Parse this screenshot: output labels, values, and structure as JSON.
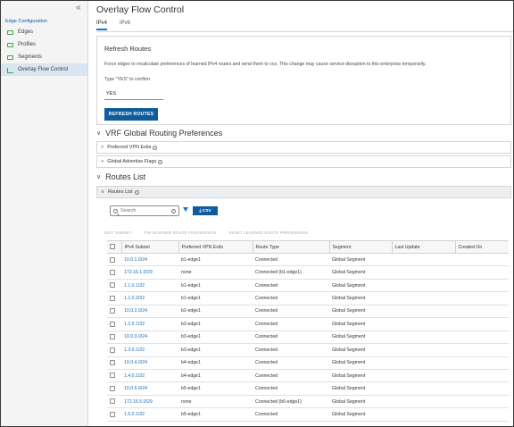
{
  "sidebar": {
    "section": "Edge Configuration",
    "items": [
      {
        "label": "Edges",
        "icon": "edge-icon"
      },
      {
        "label": "Profiles",
        "icon": "profile-icon"
      },
      {
        "label": "Segments",
        "icon": "segment-icon"
      },
      {
        "label": "Overlay Flow Control",
        "icon": "flow-icon",
        "active": true
      }
    ]
  },
  "page": {
    "title": "Overlay Flow Control",
    "tabs": [
      "IPv4",
      "IPv6"
    ],
    "active_tab": "IPv4"
  },
  "refresh": {
    "title": "Refresh Routes",
    "description": "Force edges to recalculate preferences of learned IPv4 routes and send them to vco. This change may cause service disruption to this enterprise temporarily.",
    "confirm_label": "Type \"YES\" to confirm",
    "input_value": "YES",
    "button_label": "REFRESH ROUTES"
  },
  "vrf": {
    "title": "VRF Global Routing Preferences",
    "items": [
      "Preferred VPN Exits",
      "Global Advertise Flags"
    ]
  },
  "routes": {
    "title": "Routes List",
    "panel_label": "Routes List",
    "search_placeholder": "Search",
    "csv_label": "⤓ CSV",
    "actions": [
      "EDIT SUBNET",
      "PIN LEARNED ROUTE PREFERENCE",
      "RESET LEARNED ROUTE PREFERENCE"
    ],
    "columns": [
      "IPv4 Subnet",
      "Preferred VPN Exits",
      "Route Type",
      "Segment",
      "Last Update",
      "Created On"
    ],
    "rows": [
      [
        "10.0.1.0/24",
        "b1-edge1",
        "Connected",
        "Global Segment"
      ],
      [
        "172.16.1.0/29",
        "none",
        "Connected (b1-edge1)",
        "Global Segment"
      ],
      [
        "1.1.0.1/32",
        "b1-edge1",
        "Connected",
        "Global Segment"
      ],
      [
        "1.1.0.2/32",
        "b1-edge1",
        "Connected",
        "Global Segment"
      ],
      [
        "10.0.2.0/24",
        "b2-edge1",
        "Connected",
        "Global Segment"
      ],
      [
        "1.2.0.1/32",
        "b2-edge1",
        "Connected",
        "Global Segment"
      ],
      [
        "10.0.3.0/24",
        "b3-edge1",
        "Connected",
        "Global Segment"
      ],
      [
        "1.3.0.1/32",
        "b3-edge1",
        "Connected",
        "Global Segment"
      ],
      [
        "10.0.4.0/24",
        "b4-edge1",
        "Connected",
        "Global Segment"
      ],
      [
        "1.4.0.1/32",
        "b4-edge1",
        "Connected",
        "Global Segment"
      ],
      [
        "10.0.5.0/24",
        "b5-edge1",
        "Connected",
        "Global Segment"
      ],
      [
        "172.16.5.0/29",
        "none",
        "Connected (b5-edge1)",
        "Global Segment"
      ],
      [
        "1.5.0.1/32",
        "b5-edge1",
        "Connected",
        "Global Segment"
      ]
    ]
  },
  "colors": {
    "accent": "#0f5b9c",
    "link": "#1a6bb8",
    "active_bg": "#d9e6f2"
  }
}
